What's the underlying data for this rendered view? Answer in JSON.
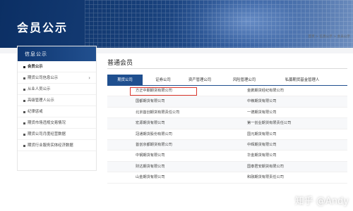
{
  "banner": {
    "title": "会员公示"
  },
  "breadcrumb": {
    "text": "首页 > 信息公示 > 会员公示"
  },
  "sidebar": {
    "header": "信息公示",
    "items": [
      {
        "label": "会员公示",
        "active": true
      },
      {
        "label": "期货公司信息公示",
        "has_children": true
      },
      {
        "label": "从业人员公示"
      },
      {
        "label": "高级管理人公示"
      },
      {
        "label": "纪律惩戒"
      },
      {
        "label": "期货市场违规交易情况"
      },
      {
        "label": "期货公司月度经营数据"
      },
      {
        "label": "期货行业服务实体经济数据"
      }
    ]
  },
  "main": {
    "title": "普通会员",
    "tabs": [
      "期货公司",
      "证券公司",
      "资产管理公司",
      "风险管理公司",
      "私募期货基金管理人"
    ],
    "rows": [
      [
        "方正中期期货有限公司",
        "金鹏期货经纪有限公司"
      ],
      [
        "国都期货有限公司",
        "中粮期货有限公司"
      ],
      [
        "北京首创期货有限责任公司",
        "一德期货有限公司"
      ],
      [
        "宏源期货有限公司",
        "第一创业期货有限责任公司"
      ],
      [
        "冠通期货股份有限公司",
        "国元期货有限公司"
      ],
      [
        "首创京都期货有限公司",
        "中辉期货有限公司"
      ],
      [
        "中钢期货有限公司",
        "华金期货有限公司"
      ],
      [
        "财达期货有限公司",
        "国泰君安期货有限公司"
      ],
      [
        "山金期货有限公司",
        "和融期货有限责任公司"
      ]
    ]
  },
  "watermark": "知乎 @Andy"
}
